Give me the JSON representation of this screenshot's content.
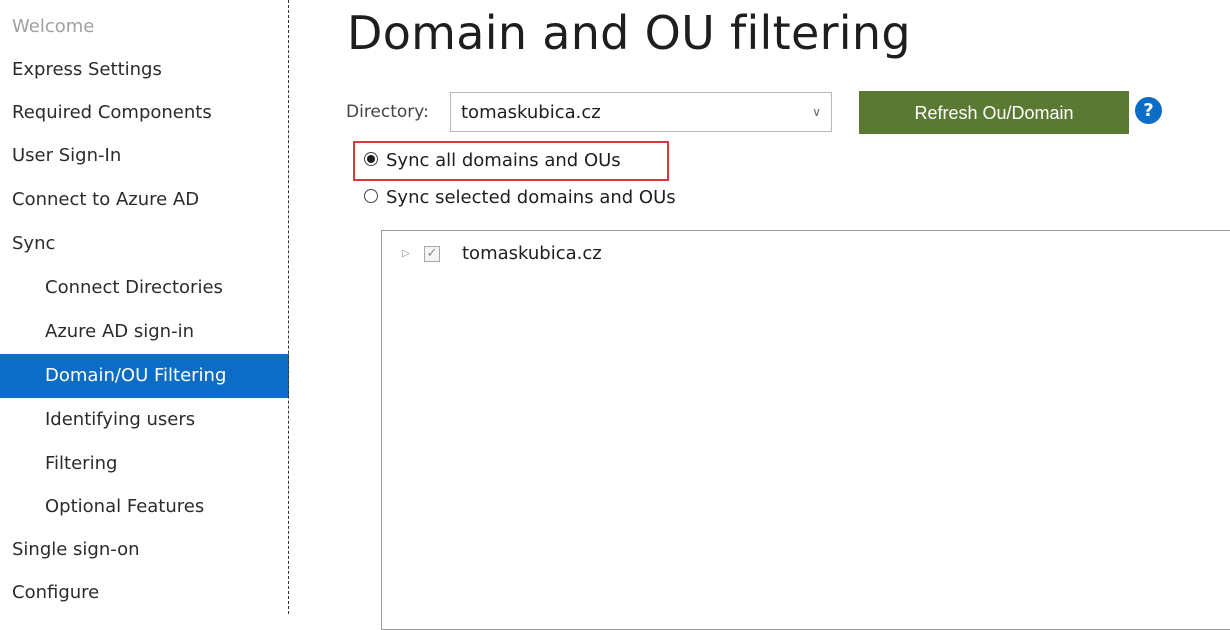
{
  "sidebar": {
    "items": [
      {
        "label": "Welcome"
      },
      {
        "label": "Express Settings"
      },
      {
        "label": "Required Components"
      },
      {
        "label": "User Sign-In"
      },
      {
        "label": "Connect to Azure AD"
      },
      {
        "label": "Sync"
      },
      {
        "label": "Connect Directories"
      },
      {
        "label": "Azure AD sign-in"
      },
      {
        "label": "Domain/OU Filtering"
      },
      {
        "label": "Identifying users"
      },
      {
        "label": "Filtering"
      },
      {
        "label": "Optional Features"
      },
      {
        "label": "Single sign-on"
      },
      {
        "label": "Configure"
      }
    ]
  },
  "main": {
    "title": "Domain and OU filtering",
    "directory_label": "Directory:",
    "directory_value": "tomaskubica.cz",
    "refresh_label": "Refresh Ou/Domain",
    "help_glyph": "?",
    "radio_all": "Sync all domains and OUs",
    "radio_selected": "Sync selected domains and OUs",
    "tree": [
      {
        "label": "tomaskubica.cz",
        "checked": true
      }
    ]
  },
  "colors": {
    "accent": "#0b6dc6",
    "button": "#5a7a34",
    "highlight": "#d9363e"
  },
  "icons": {
    "select": "chevron-down-icon",
    "help": "help-icon",
    "tree_expander": "triangle-right-icon",
    "tree_checkbox": "checkmark-icon"
  }
}
